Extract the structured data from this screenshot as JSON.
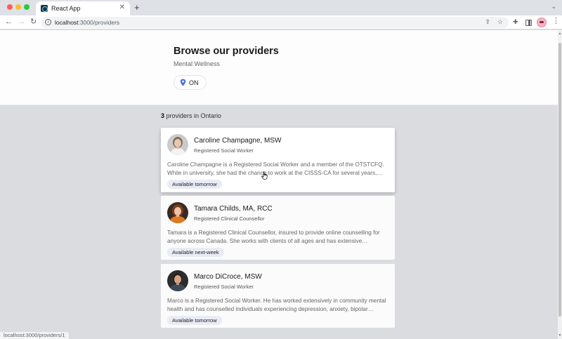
{
  "browser": {
    "tab_title": "React App",
    "tab_close": "✕",
    "new_tab": "+",
    "url_host": "localhost",
    "url_path": ":3000/providers",
    "status_url": "localhost:3000/providers/1",
    "icons": {
      "back": "arrow-left-icon",
      "forward": "arrow-right-icon",
      "reload": "reload-icon",
      "info": "info-icon",
      "share": "share-icon",
      "bookmark": "star-icon",
      "extensions": "puzzle-icon",
      "side_panel": "side-panel-icon",
      "more": "kebab-menu-icon"
    }
  },
  "hero": {
    "title": "Browse our providers",
    "subtitle": "Mental Wellness",
    "region": "ON"
  },
  "results": {
    "count": "3",
    "count_suffix": " providers in Ontario"
  },
  "providers": [
    {
      "name": "Caroline Champagne, MSW",
      "role": "Registered Social Worker",
      "bio": "Caroline Champagne is a Registered Social Worker and a member of the OTSTCFQ. While in university, she had the chance to work at the CISSS-CA for several years, taking on a wide range of roles.",
      "availability": "Available tomorrow"
    },
    {
      "name": "Tamara Childs, MA, RCC",
      "role": "Registered Clinical Counsellor",
      "bio": "Tamara is a Registered Clinical Counsellor, insured to provide online counselling for anyone across Canada. She works with clients of all ages and has extensive experience with a variety of concerns.",
      "availability": "Available next-week"
    },
    {
      "name": "Marco DiCroce, MSW",
      "role": "Registered Social Worker",
      "bio": "Marco is a Registered Social Worker. He has worked extensively in community mental health and has counselled individuals experiencing depression, anxiety, bipolar disorder and more.",
      "availability": "Available tomorrow"
    }
  ],
  "colors": {
    "accent": "#4a6fd8",
    "badge_bg": "#e9ebf5",
    "page_bg": "#dadce0"
  }
}
